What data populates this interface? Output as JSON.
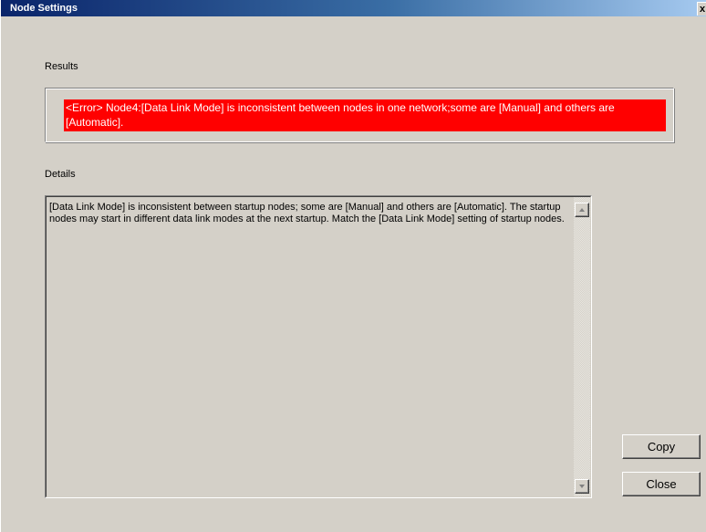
{
  "window": {
    "title": "Node Settings",
    "close_glyph": "x"
  },
  "results": {
    "label": "Results",
    "error_message": "<Error> Node4:[Data Link Mode] is inconsistent between nodes in one network;some are [Manual] and others are [Automatic].",
    "error_background": "#ff0000"
  },
  "details": {
    "label": "Details",
    "text": "[Data Link Mode] is inconsistent between startup nodes; some are [Manual] and others are [Automatic].  The startup nodes may start in different data link modes at the next startup.  Match the [Data Link Mode] setting of startup nodes."
  },
  "buttons": {
    "copy_label": "Copy",
    "close_label": "Close"
  },
  "icons": {
    "close": "close-icon",
    "scroll_up": "scroll-up-arrow-icon",
    "scroll_down": "scroll-down-arrow-icon"
  }
}
